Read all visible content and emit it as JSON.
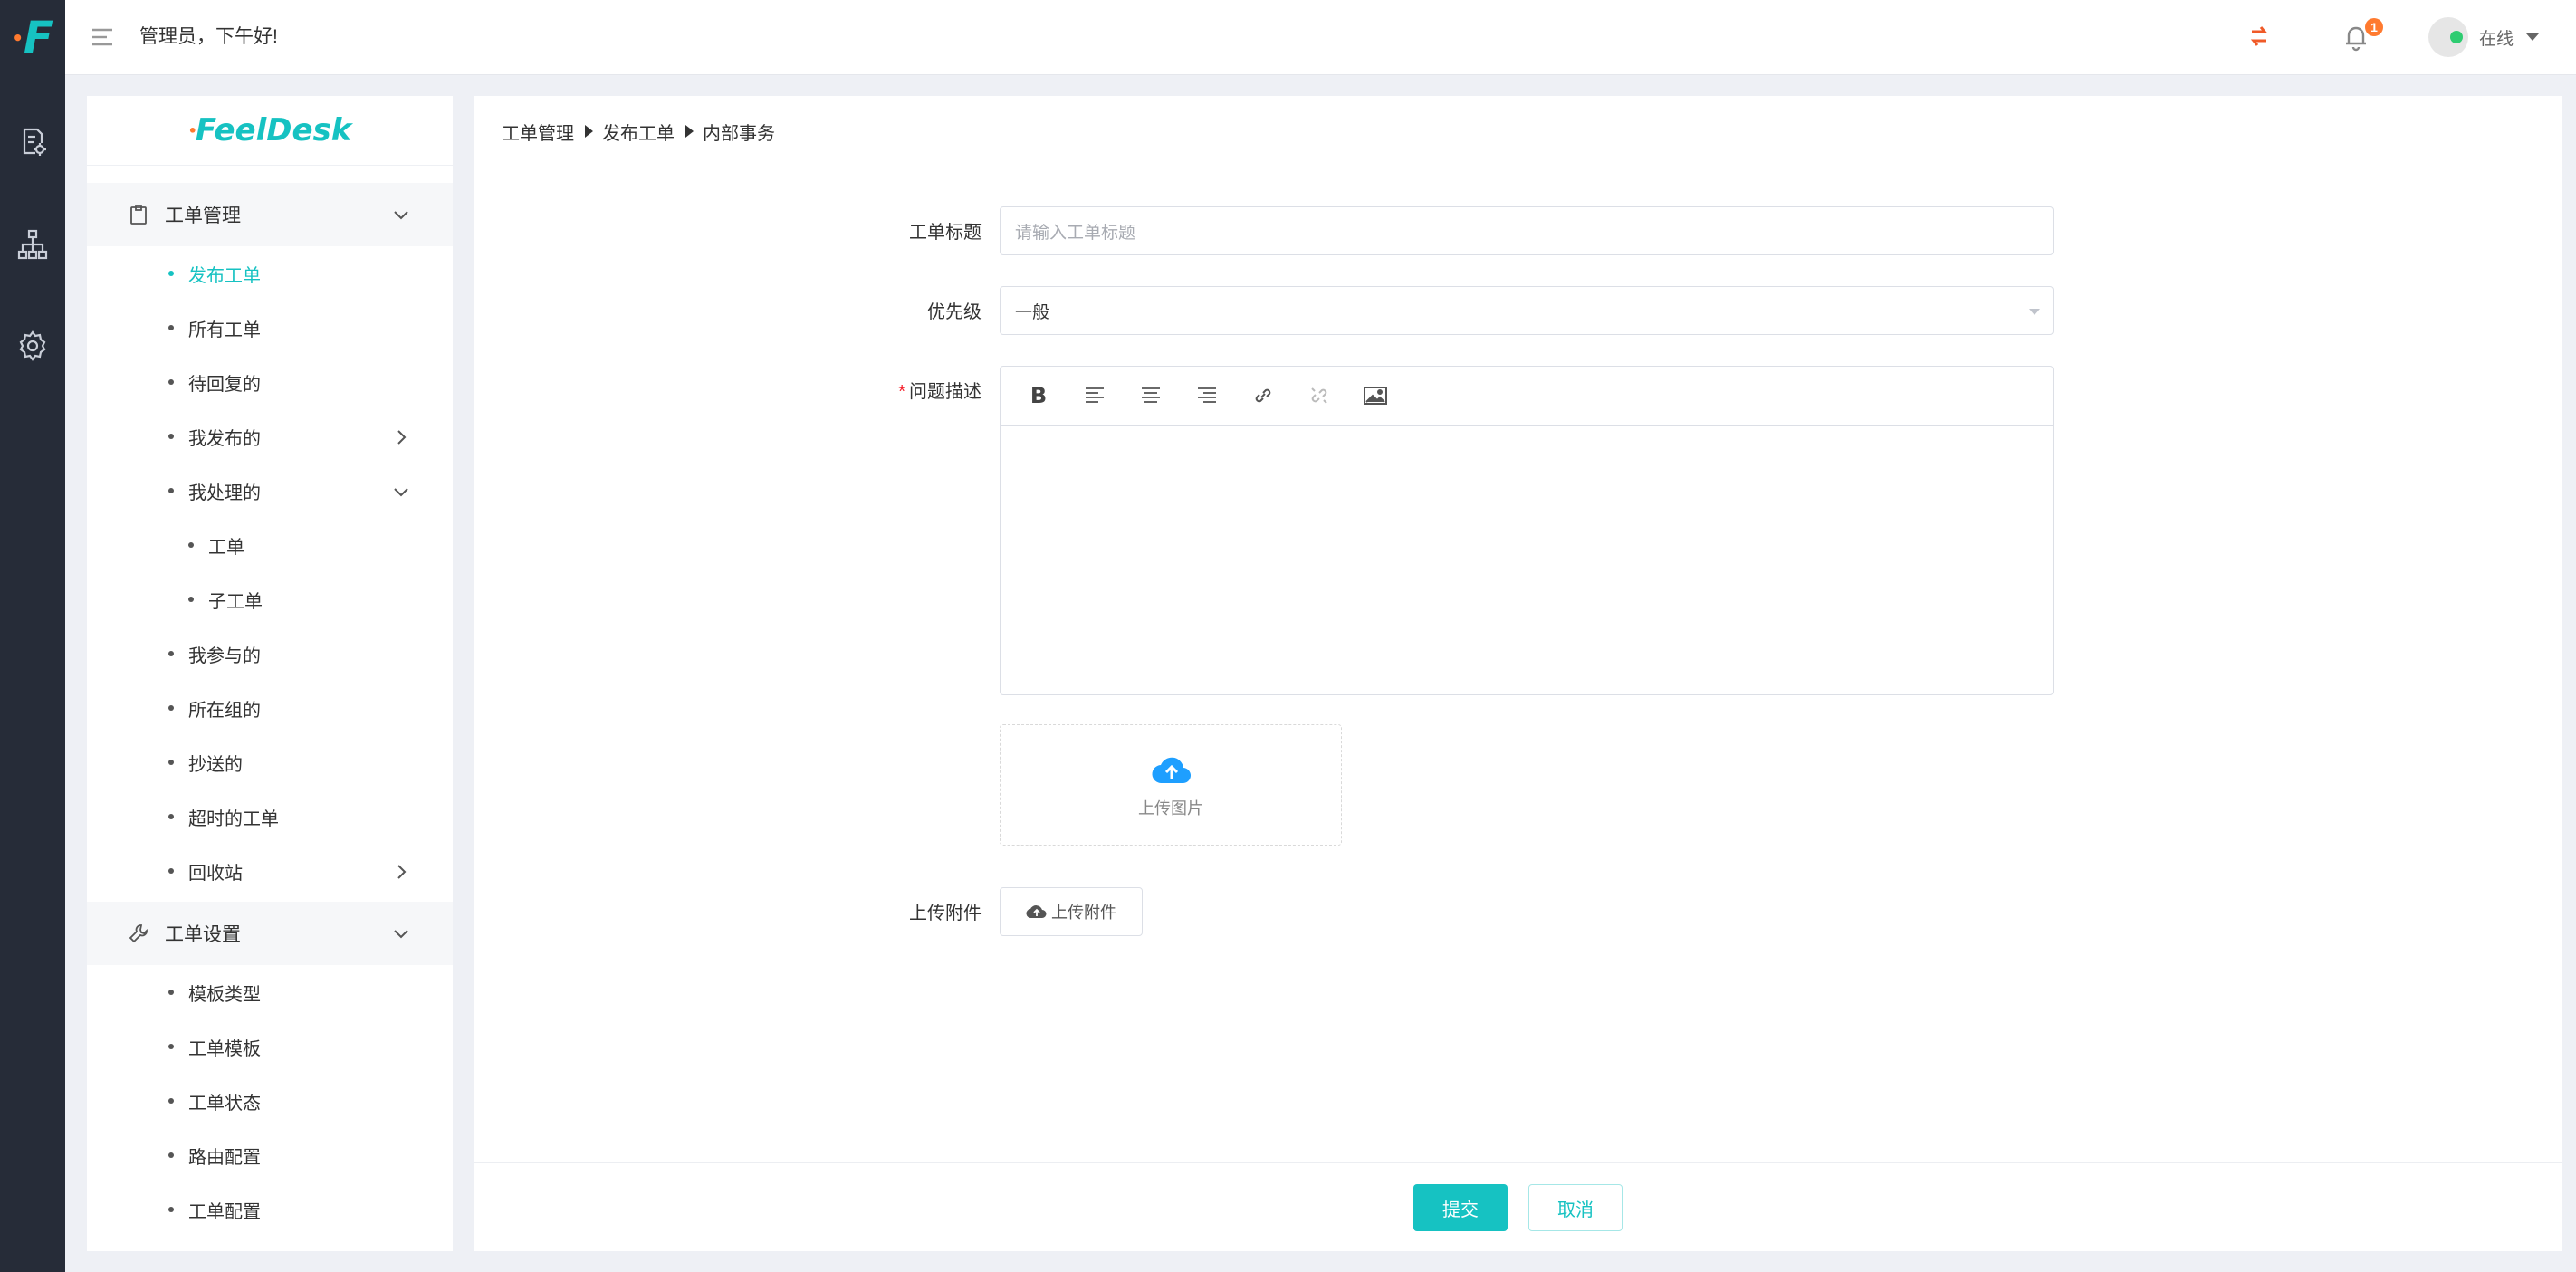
{
  "colors": {
    "brand": "#16c2c2",
    "accent": "#ff7a2f",
    "rail": "#262c38",
    "online": "#2ecc71",
    "required": "#f5222d"
  },
  "rail": {
    "logo_letter": "F",
    "icons": [
      "ticket-settings-icon",
      "org-structure-icon",
      "gear-icon"
    ]
  },
  "topbar": {
    "greeting": "管理员，下午好!",
    "notification_count": "1",
    "status_label": "在线"
  },
  "sidebar": {
    "brand": "FeelDesk",
    "section1": {
      "label": "工单管理",
      "items": [
        {
          "label": "发布工单",
          "active": true
        },
        {
          "label": "所有工单"
        },
        {
          "label": "待回复的"
        },
        {
          "label": "我发布的"
        },
        {
          "label": "我处理的"
        },
        {
          "label": "工单"
        },
        {
          "label": "子工单"
        },
        {
          "label": "我参与的"
        },
        {
          "label": "所在组的"
        },
        {
          "label": "抄送的"
        },
        {
          "label": "超时的工单"
        },
        {
          "label": "回收站"
        }
      ]
    },
    "section2": {
      "label": "工单设置",
      "items": [
        {
          "label": "模板类型"
        },
        {
          "label": "工单模板"
        },
        {
          "label": "工单状态"
        },
        {
          "label": "路由配置"
        },
        {
          "label": "工单配置"
        }
      ]
    }
  },
  "breadcrumb": [
    "工单管理",
    "发布工单",
    "内部事务"
  ],
  "form": {
    "title_label": "工单标题",
    "title_placeholder": "请输入工单标题",
    "priority_label": "优先级",
    "priority_value": "一般",
    "description_label": "问题描述",
    "description_required": "*",
    "editor_toolbar": [
      "bold-icon",
      "align-left-icon",
      "align-center-icon",
      "align-right-icon",
      "link-icon",
      "unlink-icon",
      "image-icon"
    ],
    "upload_image_label": "上传图片",
    "attachment_label": "上传附件",
    "attachment_button": "上传附件"
  },
  "footer": {
    "submit": "提交",
    "cancel": "取消"
  }
}
